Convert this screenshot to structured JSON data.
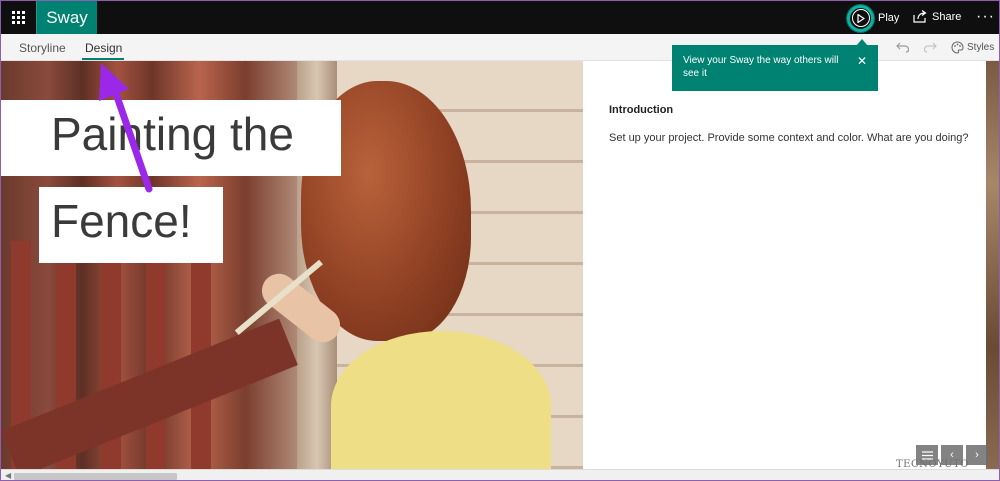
{
  "app": {
    "name": "Sway"
  },
  "header": {
    "play_label": "Play",
    "share_label": "Share",
    "more_label": "···"
  },
  "tabs": [
    {
      "label": "Storyline",
      "active": false
    },
    {
      "label": "Design",
      "active": true
    }
  ],
  "toolbar": {
    "styles_label": "Styles"
  },
  "tooltip": {
    "text": "View your Sway the way others will see it",
    "close": "✕"
  },
  "card": {
    "title_line1": "Painting the",
    "title_line2": "Fence!"
  },
  "section": {
    "heading": "Introduction",
    "body": "Set up your project. Provide some context and color.  What are you doing?"
  },
  "nav": {
    "prev": "‹",
    "next": "›"
  },
  "watermark": "TECNOYUTO",
  "colors": {
    "accent": "#008272",
    "topbar": "#0f0f0f",
    "arrow": "#9b27e8"
  }
}
